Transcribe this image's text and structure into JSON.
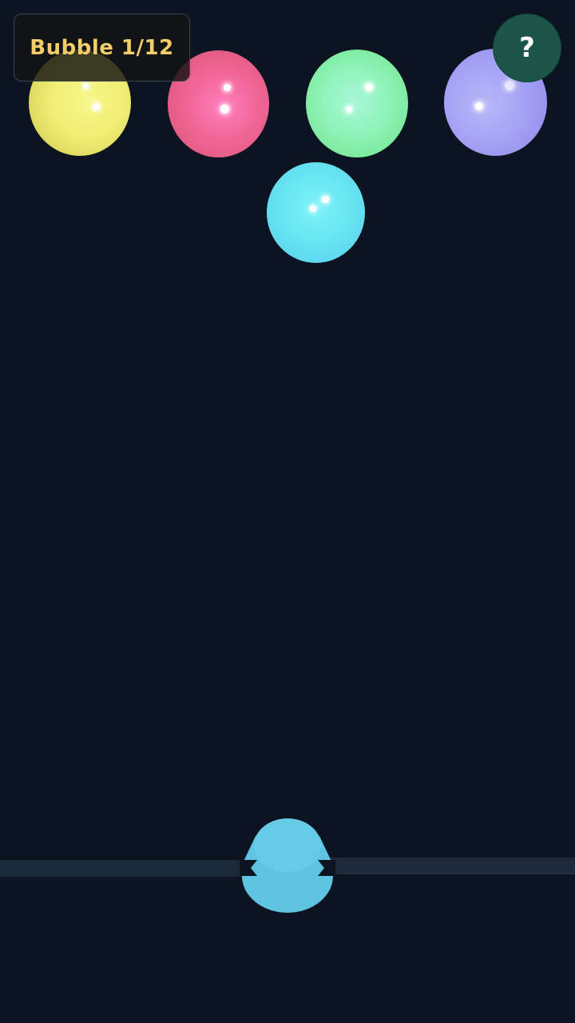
{
  "hud": {
    "counter_label": "Bubble 1/12",
    "help_label": "?",
    "counter_text_color": "#f2cd6a",
    "help_bg_color": "#1c5448"
  },
  "background_color": "#0b1420",
  "bubbles": [
    {
      "color": "yellow",
      "hex": "#f2f17a"
    },
    {
      "color": "pink",
      "hex": "#ee6b92"
    },
    {
      "color": "green",
      "hex": "#8ef4a4"
    },
    {
      "color": "lavender",
      "hex": "#a9a6f6"
    },
    {
      "color": "cyan",
      "hex": "#6fe6f2"
    }
  ],
  "launcher": {
    "loaded_bubble_color": "cyan",
    "hex": "#5ec7e4"
  },
  "icons": {
    "help": "question-mark-icon"
  }
}
